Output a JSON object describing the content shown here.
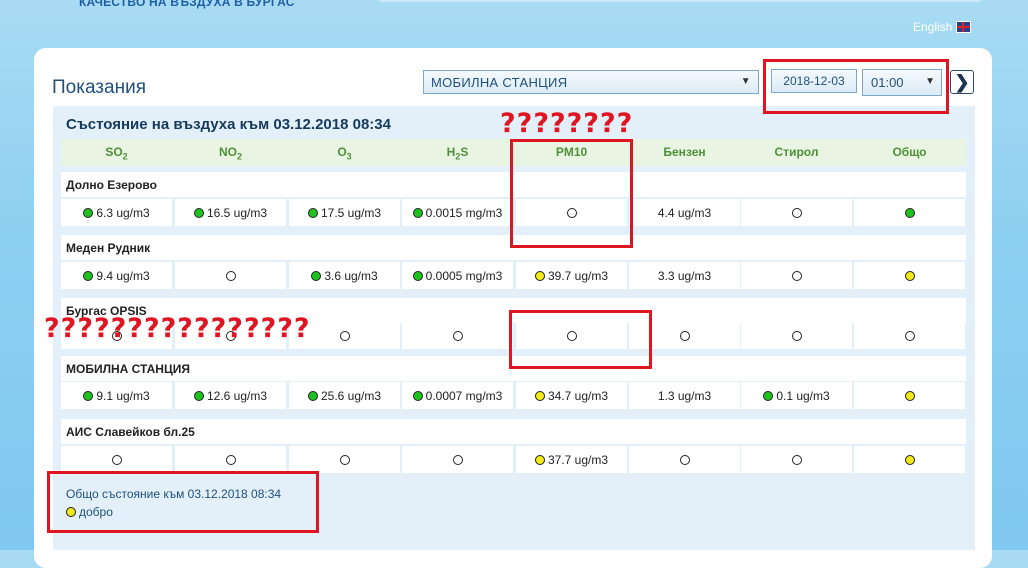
{
  "header": {
    "title": "КАЧЕСТВО НА ВЪЗДУХА В БУРГАС",
    "language_link": "English",
    "flag_icon": "uk-flag-icon"
  },
  "panel": {
    "title": "Показания"
  },
  "controls": {
    "station_select": "МОБИЛНА СТАНЦИЯ",
    "date": "2018-12-03",
    "time_select": "01:00",
    "next_icon": "chevron-right-icon"
  },
  "table": {
    "state_title": "Състояние на въздуха към 03.12.2018 08:34",
    "columns": [
      {
        "main": "SO",
        "sub": "2"
      },
      {
        "main": "NO",
        "sub": "2"
      },
      {
        "main": "O",
        "sub": "3"
      },
      {
        "main": "H",
        "sub": "2",
        "tail": "S"
      },
      {
        "main": "PM10"
      },
      {
        "main": "Бензен"
      },
      {
        "main": "Стирол"
      },
      {
        "main": "Общо"
      }
    ],
    "stations": [
      {
        "name": "Долно Езерово",
        "cells": [
          {
            "status": "green",
            "value": "6.3 ug/m3"
          },
          {
            "status": "green",
            "value": "16.5 ug/m3"
          },
          {
            "status": "green",
            "value": "17.5 ug/m3"
          },
          {
            "status": "green",
            "value": "0.0015 mg/m3"
          },
          {
            "status": "empty",
            "value": ""
          },
          {
            "status": "none",
            "value": "4.4 ug/m3"
          },
          {
            "status": "empty",
            "value": ""
          },
          {
            "status": "green",
            "value": ""
          }
        ]
      },
      {
        "name": "Меден Рудник",
        "cells": [
          {
            "status": "green",
            "value": "9.4 ug/m3"
          },
          {
            "status": "empty",
            "value": ""
          },
          {
            "status": "green",
            "value": "3.6 ug/m3"
          },
          {
            "status": "green",
            "value": "0.0005 mg/m3"
          },
          {
            "status": "yellow",
            "value": "39.7 ug/m3"
          },
          {
            "status": "none",
            "value": "3.3 ug/m3"
          },
          {
            "status": "empty",
            "value": ""
          },
          {
            "status": "yellow",
            "value": ""
          }
        ]
      },
      {
        "name": "Бургас OPSIS",
        "cells": [
          {
            "status": "empty",
            "value": ""
          },
          {
            "status": "empty",
            "value": ""
          },
          {
            "status": "empty",
            "value": ""
          },
          {
            "status": "empty",
            "value": ""
          },
          {
            "status": "empty",
            "value": ""
          },
          {
            "status": "empty",
            "value": ""
          },
          {
            "status": "empty",
            "value": ""
          },
          {
            "status": "empty",
            "value": ""
          }
        ]
      },
      {
        "name": "МОБИЛНА СТАНЦИЯ",
        "cells": [
          {
            "status": "green",
            "value": "9.1 ug/m3"
          },
          {
            "status": "green",
            "value": "12.6 ug/m3"
          },
          {
            "status": "green",
            "value": "25.6 ug/m3"
          },
          {
            "status": "green",
            "value": "0.0007 mg/m3"
          },
          {
            "status": "yellow",
            "value": "34.7 ug/m3"
          },
          {
            "status": "none",
            "value": "1.3 ug/m3"
          },
          {
            "status": "green",
            "value": "0.1 ug/m3"
          },
          {
            "status": "yellow",
            "value": ""
          }
        ]
      },
      {
        "name": "АИС Славейков бл.25",
        "cells": [
          {
            "status": "empty",
            "value": ""
          },
          {
            "status": "empty",
            "value": ""
          },
          {
            "status": "empty",
            "value": ""
          },
          {
            "status": "empty",
            "value": ""
          },
          {
            "status": "yellow",
            "value": "37.7 ug/m3"
          },
          {
            "status": "empty",
            "value": ""
          },
          {
            "status": "empty",
            "value": ""
          },
          {
            "status": "yellow",
            "value": ""
          }
        ]
      }
    ]
  },
  "summary": {
    "title": "Общо състояние към 03.12.2018 08:34",
    "status": "yellow",
    "label": "добро"
  },
  "annotations": {
    "pm10_question": "????????",
    "opsis_question": "????????????????"
  },
  "colors": {
    "green": "#1ec21e",
    "yellow": "#f4ea1a",
    "annotation_red": "#e01522"
  }
}
